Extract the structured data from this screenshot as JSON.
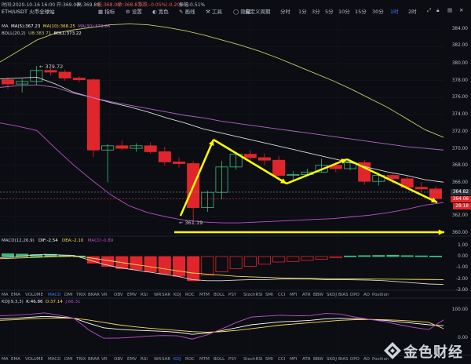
{
  "header": {
    "pair": "ETH/USDT",
    "exchange": "火币全球站",
    "date_info": "时间:2020-10-16 16:00",
    "open": "开:369.00",
    "high": "高:369.89",
    "low": "低:368.00",
    "close": "收:368.87",
    "change": "涨跌:-0.05%(-0.20)",
    "amplitude": "振幅:0.51%"
  },
  "toolbar": {
    "tools": [
      "指标",
      "设置",
      "宽色",
      "画线",
      "工具",
      "隐藏"
    ],
    "custom_period": "自定义周期",
    "timeframes": [
      "分时",
      "1分",
      "3分",
      "5分",
      "10分",
      "15分",
      "30分",
      "1时",
      "2时"
    ],
    "active_timeframe": "1时",
    "right_icons": [
      "fullscreen-icon",
      "lock-icon",
      "chart-type-icon",
      "close-icon"
    ]
  },
  "legends": {
    "ma_label": "MA",
    "ma5": "MA(5):367.23",
    "ma10": "MA(10):368.25",
    "ma30": "MA(30):373.86",
    "boll_label": "BOLL(20,2)",
    "boll_ub": "UB:383.71",
    "boll_mid": "BOLL:373.22",
    "macd_label": "MACD(12,26,9)",
    "macd_dif": "DIF:-2.54",
    "macd_dea": "DEA:-2.10",
    "macd_macd": "MACD:-0.89",
    "kdj_label": "KDJ(9,3,3)",
    "kdj_k": "K:46.86",
    "kdj_d": "D:37.14",
    "kdj_j": "J:66.31"
  },
  "annotations": {
    "high_mark": "379.72",
    "low_mark": "361.19",
    "arrow_color": "#ffff00"
  },
  "price_axis": [
    "384.00",
    "382.00",
    "380.00",
    "378.00",
    "376.00",
    "374.00",
    "372.00",
    "370.00",
    "368.00",
    "366.00",
    "364.82",
    "364.00",
    "28:18",
    "362.00",
    "360.00"
  ],
  "current_price": {
    "value": "364.06",
    "countdown": "28:18",
    "color": "#e0262c"
  },
  "last_close_label": "364.82",
  "macd_axis": [
    "1.00",
    "0.00",
    "-1.00",
    "-2.00",
    "-3.00"
  ],
  "kdj_axis": [
    "100.00",
    "0.00"
  ],
  "indicators": [
    "MA",
    "EMA",
    "VOLUME",
    "MACD",
    "DMI",
    "TRIX",
    "BRAR",
    "VR",
    "OBV",
    "EMV",
    "RSI",
    "WR",
    "SAR",
    "KDJ",
    "ROC",
    "MTM",
    "BOLL",
    "PSY",
    "StochRSI",
    "SMI",
    "CCI",
    "MFI",
    "ATR",
    "BBW",
    "SKDJ",
    "BIAS",
    "DPO",
    "AO",
    "Position"
  ],
  "indicators_bottom": [
    "MA",
    "EMA",
    "VOLUME",
    "MACD",
    "DMI",
    "TRIX",
    "BRAR",
    "VR",
    "OBV",
    "EMV",
    "RSI",
    "WR",
    "SAR",
    "KDJ",
    "ROC",
    "MTM",
    "BOLL",
    "PSY",
    "StochRSI",
    "SMI",
    "CCI",
    "MFI",
    "ATR",
    "BBW",
    "SKDJ",
    "BIAS",
    "DPO",
    "AO",
    "Position"
  ],
  "active_indicators": {
    "mid": "MACD",
    "bottom": "KDJ"
  },
  "watermark": "金色财经",
  "colors": {
    "up": "#3dbd7d",
    "down": "#e0262c",
    "boll_upper": "#c8c864",
    "boll_mid": "#ffffff",
    "boll_lower": "#c04fd0",
    "ma30": "#b266c8",
    "accent": "#3d7bff"
  },
  "chart_data": [
    {
      "type": "candlestick",
      "title": "ETH/USDT 1H",
      "ylim": [
        360,
        385
      ],
      "ohlc": [
        [
          378.1,
          378.4,
          377.0,
          377.6
        ],
        [
          377.6,
          378.2,
          376.6,
          377.9
        ],
        [
          377.9,
          379.72,
          377.5,
          379.2
        ],
        [
          379.2,
          379.6,
          378.6,
          379.0
        ],
        [
          379.0,
          379.3,
          378.0,
          378.3
        ],
        [
          378.3,
          378.5,
          377.8,
          378.1
        ],
        [
          378.1,
          378.3,
          369.0,
          369.8
        ],
        [
          369.8,
          370.5,
          366.0,
          370.3
        ],
        [
          370.3,
          370.9,
          369.8,
          370.0
        ],
        [
          370.0,
          370.6,
          369.6,
          370.3
        ],
        [
          370.3,
          370.7,
          369.4,
          369.6
        ],
        [
          369.6,
          370.2,
          368.0,
          368.4
        ],
        [
          368.4,
          368.9,
          367.7,
          368.2
        ],
        [
          368.2,
          368.5,
          361.19,
          363.0
        ],
        [
          363.0,
          365.0,
          362.5,
          364.8
        ],
        [
          364.8,
          368.5,
          364.0,
          367.8
        ],
        [
          367.8,
          369.5,
          367.5,
          369.3
        ],
        [
          369.3,
          369.8,
          368.2,
          368.9
        ],
        [
          368.9,
          369.4,
          368.0,
          368.6
        ],
        [
          368.6,
          369.1,
          366.4,
          366.8
        ],
        [
          366.8,
          367.3,
          366.1,
          366.9
        ],
        [
          366.9,
          367.6,
          366.8,
          367.2
        ],
        [
          367.2,
          368.8,
          367.1,
          368.0
        ],
        [
          368.0,
          368.4,
          367.2,
          367.6
        ],
        [
          367.6,
          368.5,
          367.4,
          368.3
        ],
        [
          368.3,
          368.6,
          365.7,
          366.1
        ],
        [
          366.1,
          367.1,
          365.6,
          366.8
        ],
        [
          366.8,
          367.0,
          365.8,
          366.4
        ],
        [
          366.4,
          366.7,
          365.2,
          365.4
        ],
        [
          365.4,
          366.0,
          364.8,
          365.2
        ],
        [
          365.2,
          365.5,
          364.0,
          364.06
        ]
      ],
      "boll_upper": [
        380.2,
        381.5,
        382.8,
        383.6,
        384.0,
        384.3,
        384.6,
        384.7,
        384.6,
        384.3,
        383.9,
        383.4,
        382.8,
        382.2,
        381.5,
        380.7,
        379.8,
        378.9,
        378.0,
        377.0,
        375.9,
        374.8,
        373.5,
        372.2,
        371.3
      ],
      "boll_mid": [
        378.2,
        378.3,
        378.4,
        377.6,
        376.6,
        376.0,
        375.4,
        374.9,
        374.3,
        373.6,
        373.0,
        372.3,
        371.8,
        371.3,
        370.8,
        370.3,
        369.8,
        369.3,
        368.8,
        368.3,
        367.7,
        367.2,
        366.8,
        366.3,
        366.0
      ],
      "boll_lower": [
        373.0,
        372.6,
        372.1,
        370.0,
        368.0,
        366.2,
        364.5,
        363.2,
        362.4,
        361.9,
        361.5,
        361.3,
        361.2,
        361.2,
        361.3,
        361.4,
        361.5,
        361.6,
        361.7,
        361.9,
        362.1,
        362.4,
        362.8,
        363.3,
        363.6
      ],
      "ma30": [
        377.2,
        377.4,
        377.5,
        377.2,
        376.5,
        376.0,
        375.5,
        375.1,
        374.7,
        374.3,
        373.9,
        373.6,
        373.2,
        372.9,
        372.6,
        372.3,
        372.0,
        371.7,
        371.4,
        371.1,
        370.8,
        370.5,
        370.2,
        370.0,
        369.8
      ]
    },
    {
      "type": "bar",
      "title": "MACD(12,26,9)",
      "ylim": [
        -3,
        1.5
      ],
      "values": [
        0.25,
        0.22,
        0.18,
        0.2,
        0.12,
        0.05,
        -0.6,
        -0.9,
        -1.1,
        -1.2,
        -1.4,
        -1.6,
        -1.8,
        -2.2,
        -1.7,
        -1.4,
        -1.1,
        -0.9,
        -0.7,
        -0.5,
        -0.45,
        -0.35,
        -0.25,
        -0.1,
        0.05,
        0.08,
        0.1,
        0.12,
        0.08,
        0.06,
        0.04
      ],
      "dif": [
        -0.1,
        -0.05,
        0.1,
        0.2,
        0.15,
        0.1,
        -0.3,
        -0.7,
        -1.0,
        -1.2,
        -1.4,
        -1.6,
        -1.8,
        -2.1,
        -2.2,
        -2.2,
        -2.15,
        -2.1,
        -2.1,
        -2.05,
        -2.05,
        -2.05,
        -2.1,
        -2.1,
        -2.12,
        -2.15,
        -2.2,
        -2.3,
        -2.4,
        -2.5,
        -2.54
      ],
      "dea": [
        -0.2,
        -0.15,
        -0.1,
        -0.05,
        0.0,
        0.05,
        -0.1,
        -0.3,
        -0.5,
        -0.7,
        -0.9,
        -1.1,
        -1.3,
        -1.5,
        -1.6,
        -1.7,
        -1.8,
        -1.85,
        -1.9,
        -1.95,
        -1.98,
        -2.0,
        -2.02,
        -2.03,
        -2.04,
        -2.05,
        -2.06,
        -2.07,
        -2.08,
        -2.09,
        -2.1
      ]
    },
    {
      "type": "line",
      "title": "KDJ(9,3,3)",
      "ylim": [
        0,
        100
      ],
      "series": [
        {
          "name": "K",
          "values": [
            70,
            72,
            75,
            78,
            76,
            72,
            55,
            40,
            35,
            32,
            30,
            28,
            25,
            18,
            22,
            30,
            40,
            50,
            55,
            60,
            62,
            65,
            70,
            72,
            70,
            68,
            65,
            60,
            55,
            50,
            46.86
          ]
        },
        {
          "name": "D",
          "values": [
            65,
            67,
            70,
            72,
            73,
            72,
            66,
            58,
            50,
            44,
            39,
            35,
            31,
            27,
            25,
            27,
            31,
            37,
            43,
            49,
            53,
            57,
            61,
            65,
            67,
            68,
            67,
            65,
            62,
            58,
            37.14
          ]
        },
        {
          "name": "J",
          "values": [
            80,
            82,
            85,
            90,
            82,
            72,
            33,
            5,
            5,
            8,
            12,
            14,
            13,
            2,
            16,
            36,
            58,
            76,
            79,
            82,
            80,
            81,
            88,
            86,
            76,
            68,
            61,
            50,
            41,
            34,
            66.31
          ]
        }
      ]
    }
  ]
}
